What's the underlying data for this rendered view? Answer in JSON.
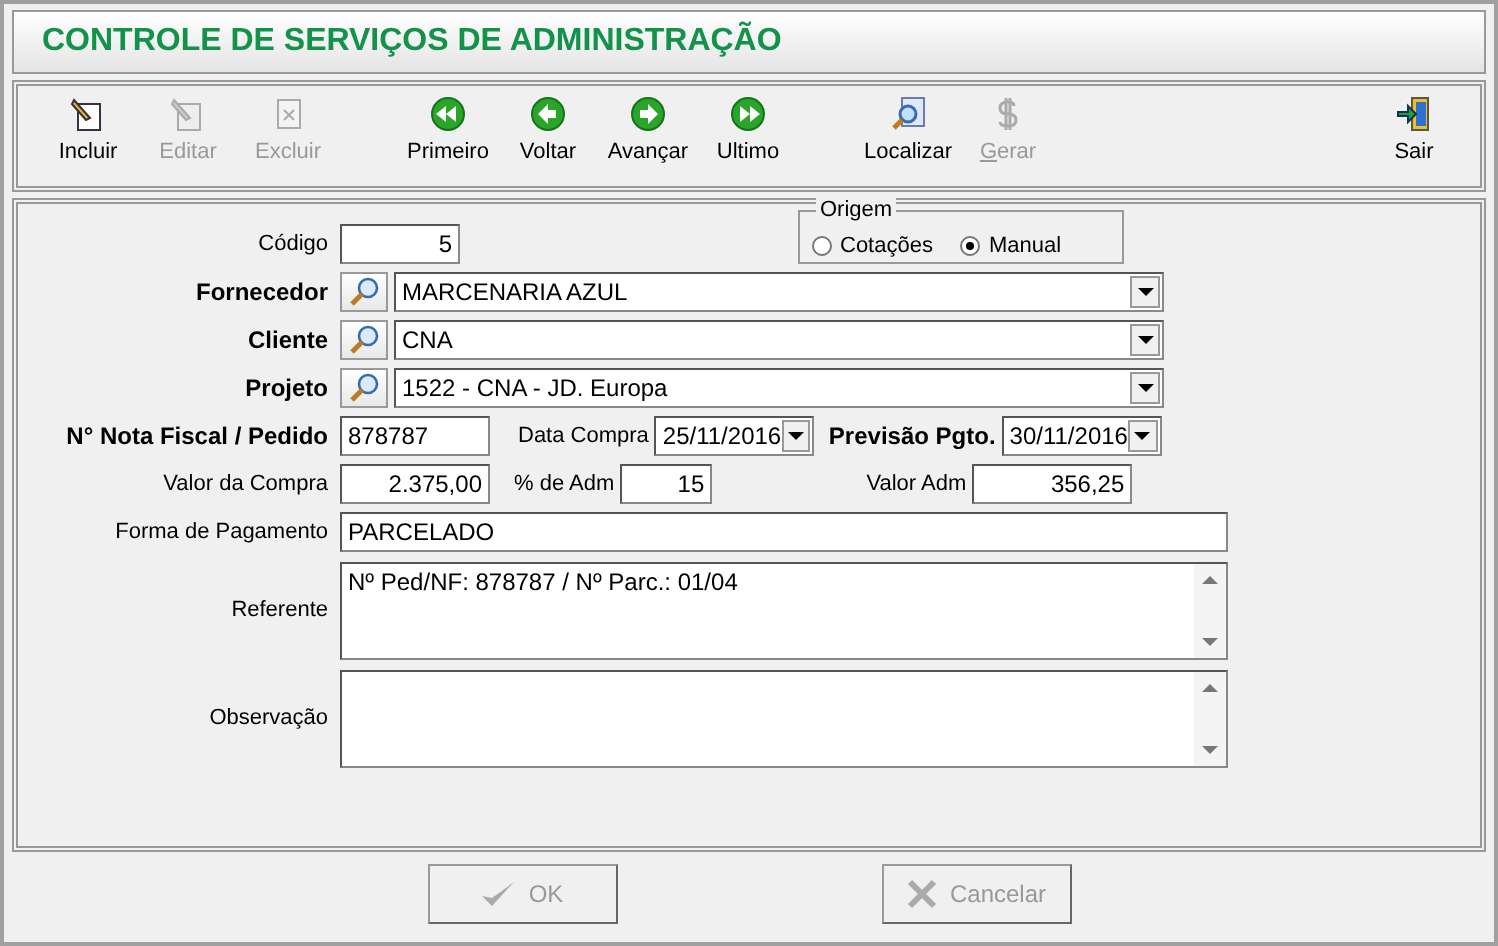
{
  "window": {
    "title": "CONTROLE DE SERVIÇOS DE ADMINISTRAÇÃO"
  },
  "toolbar": [
    {
      "label": "Incluir",
      "kind": "new",
      "disabled": false
    },
    {
      "label": "Editar",
      "kind": "edit",
      "disabled": true
    },
    {
      "label": "Excluir",
      "kind": "delete",
      "disabled": true
    },
    {
      "label": "Primeiro",
      "kind": "first",
      "disabled": false
    },
    {
      "label": "Voltar",
      "kind": "prev",
      "disabled": false
    },
    {
      "label": "Avançar",
      "kind": "next",
      "disabled": false
    },
    {
      "label": "Ultimo",
      "kind": "last",
      "disabled": false
    },
    {
      "label": "Localizar",
      "kind": "find",
      "disabled": false
    },
    {
      "label": "Gerar",
      "kind": "money",
      "disabled": true
    },
    {
      "label": "Sair",
      "kind": "exit",
      "disabled": false
    }
  ],
  "form": {
    "codigo": {
      "label": "Código",
      "value": "5"
    },
    "origem": {
      "label": "Origem",
      "options": [
        {
          "label": "Cotações",
          "selected": false
        },
        {
          "label": "Manual",
          "selected": true
        }
      ]
    },
    "lookups": [
      {
        "label": "Fornecedor",
        "value": "MARCENARIA AZUL"
      },
      {
        "label": "Cliente",
        "value": "CNA"
      },
      {
        "label": "Projeto",
        "value": "1522 - CNA - JD. Europa"
      }
    ],
    "nota": {
      "label": "N° Nota Fiscal / Pedido",
      "value": "878787"
    },
    "data_compra": {
      "label": "Data Compra",
      "value": "25/11/2016"
    },
    "previsao": {
      "label": "Previsão Pgto.",
      "value": "30/11/2016"
    },
    "valor_compra": {
      "label": "Valor da Compra",
      "value": "2.375,00"
    },
    "perc_adm": {
      "label": "% de Adm",
      "value": "15"
    },
    "valor_adm": {
      "label": "Valor Adm",
      "value": "356,25"
    },
    "forma_pagamento": {
      "label": "Forma de Pagamento",
      "value": "PARCELADO"
    },
    "referente": {
      "label": "Referente",
      "value": "Nº Ped/NF: 878787  /  Nº Parc.: 01/04"
    },
    "observacao": {
      "label": "Observação"
    }
  },
  "buttons": [
    {
      "label": "OK",
      "kind": "confirm",
      "disabled": true
    },
    {
      "label": "Cancelar",
      "kind": "cancel",
      "disabled": true
    }
  ]
}
